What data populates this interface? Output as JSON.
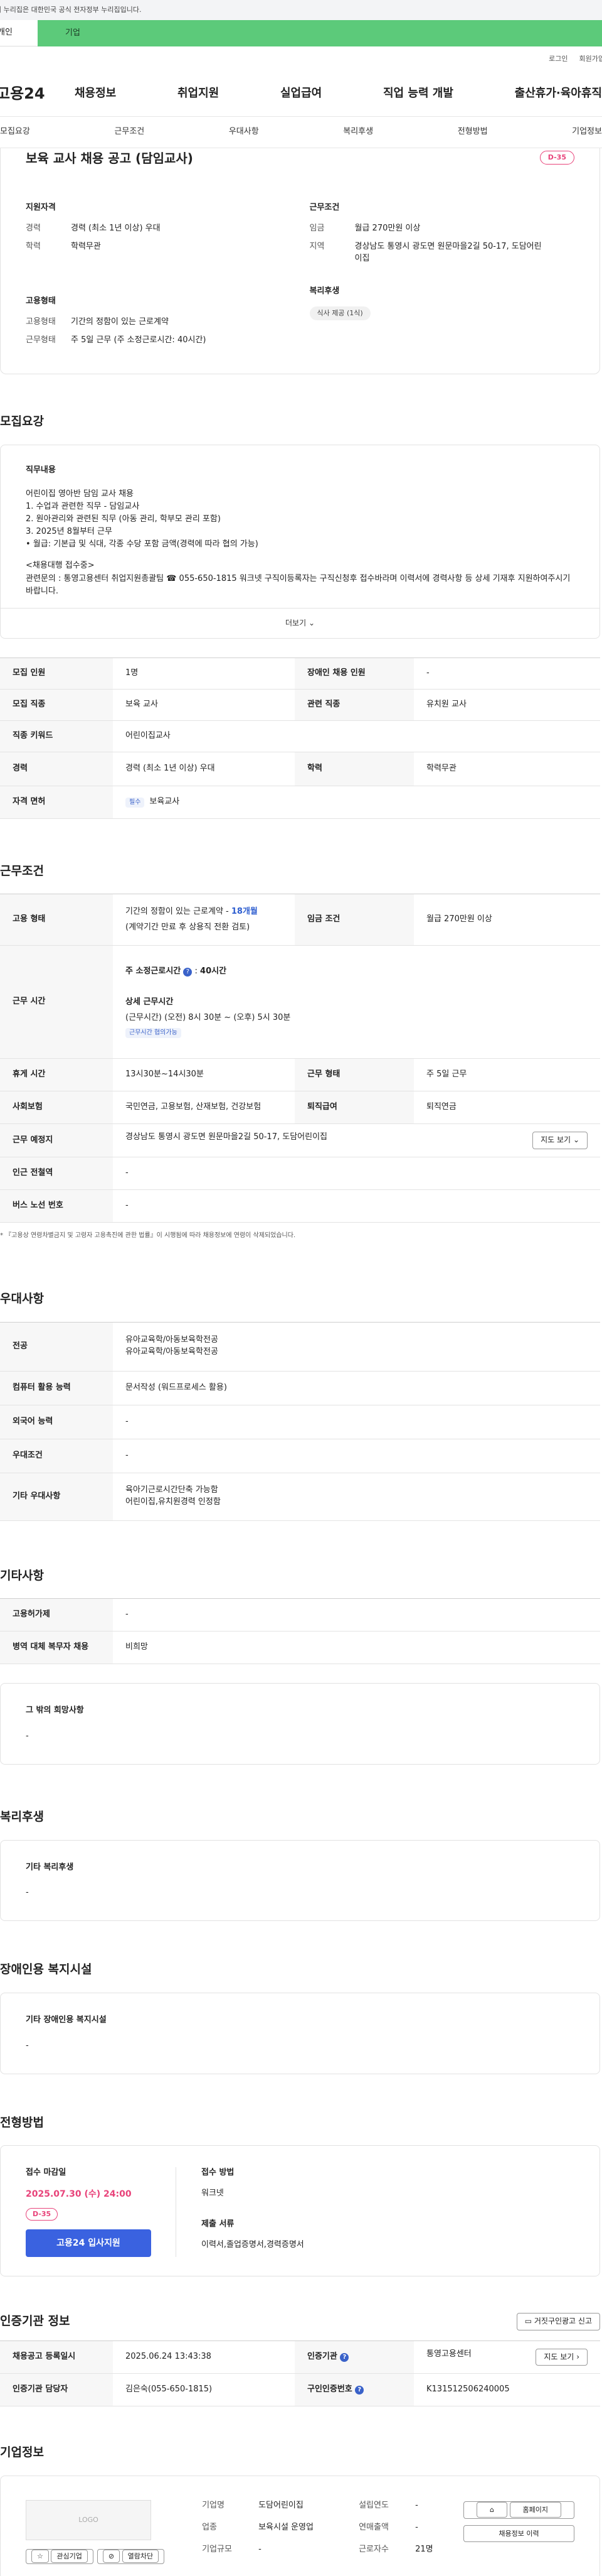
{
  "gov_banner": "이 누리집은 대한민국 공식 전자정부 누리집입니다.",
  "user_tabs": {
    "personal": "개인",
    "company": "기업"
  },
  "util": {
    "login": "로그인",
    "join": "회원가입"
  },
  "gnb": {
    "logo": "고용24",
    "menu": [
      "채용정보",
      "취업지원",
      "실업급여",
      "직업 능력 개발",
      "출산휴가·육아휴직"
    ]
  },
  "subnav": [
    "모집요강",
    "근무조건",
    "우대사항",
    "복리후생",
    "전형방법",
    "기업정보"
  ],
  "summary": {
    "title": "보육 교사 채용 공고 (담임교사)",
    "dday": "D-35",
    "qual_title": "지원자격",
    "qual": [
      {
        "k": "경력",
        "v": "경력 (최소 1년 이상) 우대"
      },
      {
        "k": "학력",
        "v": "학력무관"
      }
    ],
    "cond_title": "근무조건",
    "cond": [
      {
        "k": "임금",
        "v": "월급 270만원 이상"
      },
      {
        "k": "지역",
        "v": "경상남도 통영시 광도면 원문마을2길 50-17, 도담어린이집"
      }
    ],
    "emp_title": "고용형태",
    "emp": [
      {
        "k": "고용형태",
        "v": "기간의 정함이 있는 근로계약"
      },
      {
        "k": "근무형태",
        "v": "주 5일 근무 (주 소정근로시간: 40시간)"
      }
    ],
    "welfare_title": "복리후생",
    "welfare_tag": "식사 제공 (1식)"
  },
  "recruit": {
    "section_title": "모집요강",
    "desc_title": "직무내용",
    "desc_lines": [
      "어린이집  영아반 담임 교사 채용",
      "1. 수업과 관련한 직무 - 담임교사",
      "2. 원아관리와 관련된 직무 (아동 관리, 학부모 관리 포함)",
      "3. 2025년 8월부터 근무",
      "• 월급: 기본급 및 식대, 각종 수당 포함 금액(경력에 따라 협의 가능)",
      "",
      "<채용대행 접수중>",
      "관련문의 : 통영고용센터 취업지원총괄팀 ☎ 055-650-1815 워크넷 구직이등록자는 구직신청후 접수바라며 이력서에 경력사항 등 상세 기재후 지원하여주시기 바랍니다."
    ],
    "more_label": "더보기",
    "rows": [
      {
        "k1": "모집 인원",
        "v1": "1명",
        "k2": "장애인 채용 인원",
        "v2": "-"
      },
      {
        "k1": "모집 직종",
        "v1": "보육 교사",
        "k2": "관련 직종",
        "v2": "유치원 교사"
      },
      {
        "k1": "직종 키워드",
        "v1": "어린이집교사"
      },
      {
        "k1": "경력",
        "v1": "경력 (최소 1년 이상) 우대",
        "k2": "학력",
        "v2": "학력무관"
      }
    ],
    "license_k": "자격 면허",
    "license_tag": "필수",
    "license_v": "보육교사"
  },
  "work": {
    "section_title": "근무조건",
    "emp_k": "고용 형태",
    "emp_v1": "기간의 정함이 있는 근로계약 - ",
    "emp_months": "18개월",
    "emp_v2": "(계약기간 만료 후 상용직 전환 검토)",
    "wage_k": "임금 조건",
    "wage_v": "월급 270만원 이상",
    "hours_k": "근무 시간",
    "hours_total_label": "주 소정근로시간",
    "hours_total": "40시간",
    "hours_detail_title": "상세 근무시간",
    "hours_detail": "(근무시간) (오전) 8시 30분 ~ (오후) 5시 30분",
    "hours_tag": "근무시간 협의가능",
    "break_k": "휴게 시간",
    "break_v": "13시30분~14시30분",
    "form_k": "근무 형태",
    "form_v": "주 5일 근무",
    "ins_k": "사회보험",
    "ins_v": "국민연금, 고용보험, 산재보험, 건강보험",
    "ret_k": "퇴직급여",
    "ret_v": "퇴직연금",
    "place_k": "근무 예정지",
    "place_v": "경상남도 통영시 광도면 원문마을2길 50-17, 도담어린이집",
    "map_btn": "지도 보기",
    "station_k": "인근 전철역",
    "station_v": "-",
    "bus_k": "버스 노선 번호",
    "bus_v": "-",
    "note": "* 『고용상 연령차별금지 및 고령자 고용촉진에 관한 법률』이 시행됨에 따라 채용정보에 연령이 삭제되었습니다."
  },
  "pref": {
    "section_title": "우대사항",
    "major_k": "전공",
    "major_v": [
      "유아교육학/아동보육학전공",
      "유아교육학/아동보육학전공"
    ],
    "pc_k": "컴퓨터 활용 능력",
    "pc_v": "문서작성 (워드프로세스 활용)",
    "lang_k": "외국어 능력",
    "lang_v": "-",
    "cond_k": "우대조건",
    "cond_v": "-",
    "etc_k": "기타 우대사항",
    "etc_v": [
      "육아기근로시간단축 가능함",
      "어린이집,유치원경력 인정함"
    ]
  },
  "other": {
    "section_title": "기타사항",
    "ins_k": "고용허가제",
    "ins_v": "-",
    "mil_k": "병역 대체 복무자 채용",
    "mil_v": "비희망",
    "etc_title": "그 밖의 희망사항",
    "etc_v": "-"
  },
  "welfare": {
    "section_title": "복리후생",
    "card_title": "기타 복리후생",
    "card_v": "-"
  },
  "disabled": {
    "section_title": "장애인용 복지시설",
    "card_title": "기타 장애인용 복지시설",
    "card_v": "-"
  },
  "process": {
    "section_title": "전형방법",
    "deadline_title": "접수 마감일",
    "deadline": "2025.07.30 (수) 24:00",
    "dday": "D-35",
    "apply_btn": "고용24 입사지원",
    "method_title": "접수 방법",
    "method_v": "워크넷",
    "docs_title": "제출 서류",
    "docs_v": "이력서,졸업증명서,경력증명서"
  },
  "agency": {
    "section_title": "인증기관 정보",
    "report_btn": "거짓구인광고 신고",
    "reg_k": "채용공고 등록일시",
    "reg_v": "2025.06.24 13:43:38",
    "org_k": "인증기관",
    "org_v": "통영고용센터",
    "map_btn": "지도 보기",
    "mgr_k": "인증기관 담당자",
    "mgr_v": "김은숙(055-650-1815)",
    "id_k": "구인인증번호",
    "id_v": "K131512506240005"
  },
  "company": {
    "section_title": "기업정보",
    "logo": "LOGO",
    "fav_btn": "관심기업",
    "block_btn": "열람차단",
    "name_k": "기업명",
    "name_v": "도담어린이집",
    "found_k": "설립연도",
    "found_v": "-",
    "ind_k": "업종",
    "ind_v": "보육시설 운영업",
    "sales_k": "연매출액",
    "sales_v": "-",
    "size_k": "기업규모",
    "size_v": "-",
    "emp_k": "근로자수",
    "emp_v": "21명",
    "home_btn": "홈페이지",
    "history_btn": "채용정보 이력"
  }
}
